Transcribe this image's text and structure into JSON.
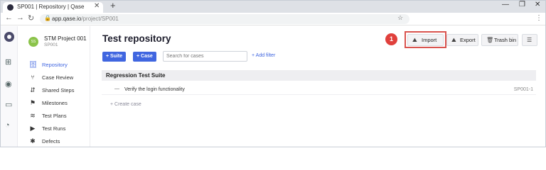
{
  "browser": {
    "tab_title": "SP001 | Repository | Qase",
    "tab_close": "✕",
    "new_tab": "+",
    "url_host": "app.qase.io",
    "url_path": "/project/SP001",
    "window_controls": [
      "—",
      "❐",
      "✕"
    ]
  },
  "icons": {
    "back": "back-arrow-icon",
    "forward": "forward-arrow-icon",
    "reload": "reload-icon",
    "lock": "lock-icon",
    "bookmark": "star-icon",
    "menu": "kebab-menu-icon"
  },
  "rail": {
    "items": [
      "qase-logo",
      "grid-icon",
      "user-icon",
      "inbox-icon",
      "chart-icon"
    ]
  },
  "project": {
    "name": "STM Project 001",
    "code": "SP001",
    "avatar_text": "SS"
  },
  "sidebar": {
    "items": [
      {
        "label": "Repository",
        "icon": "database-icon",
        "glyph": "🗄",
        "active": true
      },
      {
        "label": "Case Review",
        "icon": "branch-icon",
        "glyph": "⑂",
        "active": false
      },
      {
        "label": "Shared Steps",
        "icon": "share-icon",
        "glyph": "⇵",
        "active": false
      },
      {
        "label": "Milestones",
        "icon": "flag-icon",
        "glyph": "⚑",
        "active": false
      },
      {
        "label": "Test Plans",
        "icon": "layers-icon",
        "glyph": "≋",
        "active": false
      },
      {
        "label": "Test Runs",
        "icon": "play-icon",
        "glyph": "▶",
        "active": false
      },
      {
        "label": "Defects",
        "icon": "bug-icon",
        "glyph": "✱",
        "active": false
      }
    ]
  },
  "main": {
    "title": "Test repository",
    "suite_button": "+ Suite",
    "case_button": "+ Case",
    "search_placeholder": "Search for cases",
    "add_filter": "+ Add filter",
    "step_number": "1",
    "toolbar": {
      "import_label": "Import",
      "export_label": "Export",
      "trash_label": "Trash bin"
    },
    "suite": {
      "title": "Regression Test Suite",
      "cases": [
        {
          "title": "Verify the login functionality",
          "id": "SP001-1"
        }
      ],
      "create_case": "+ Create case"
    }
  },
  "colors": {
    "accent": "#4066e0",
    "highlight": "#d9544f",
    "badge": "#e0403c",
    "avatar": "#8bc34a"
  }
}
